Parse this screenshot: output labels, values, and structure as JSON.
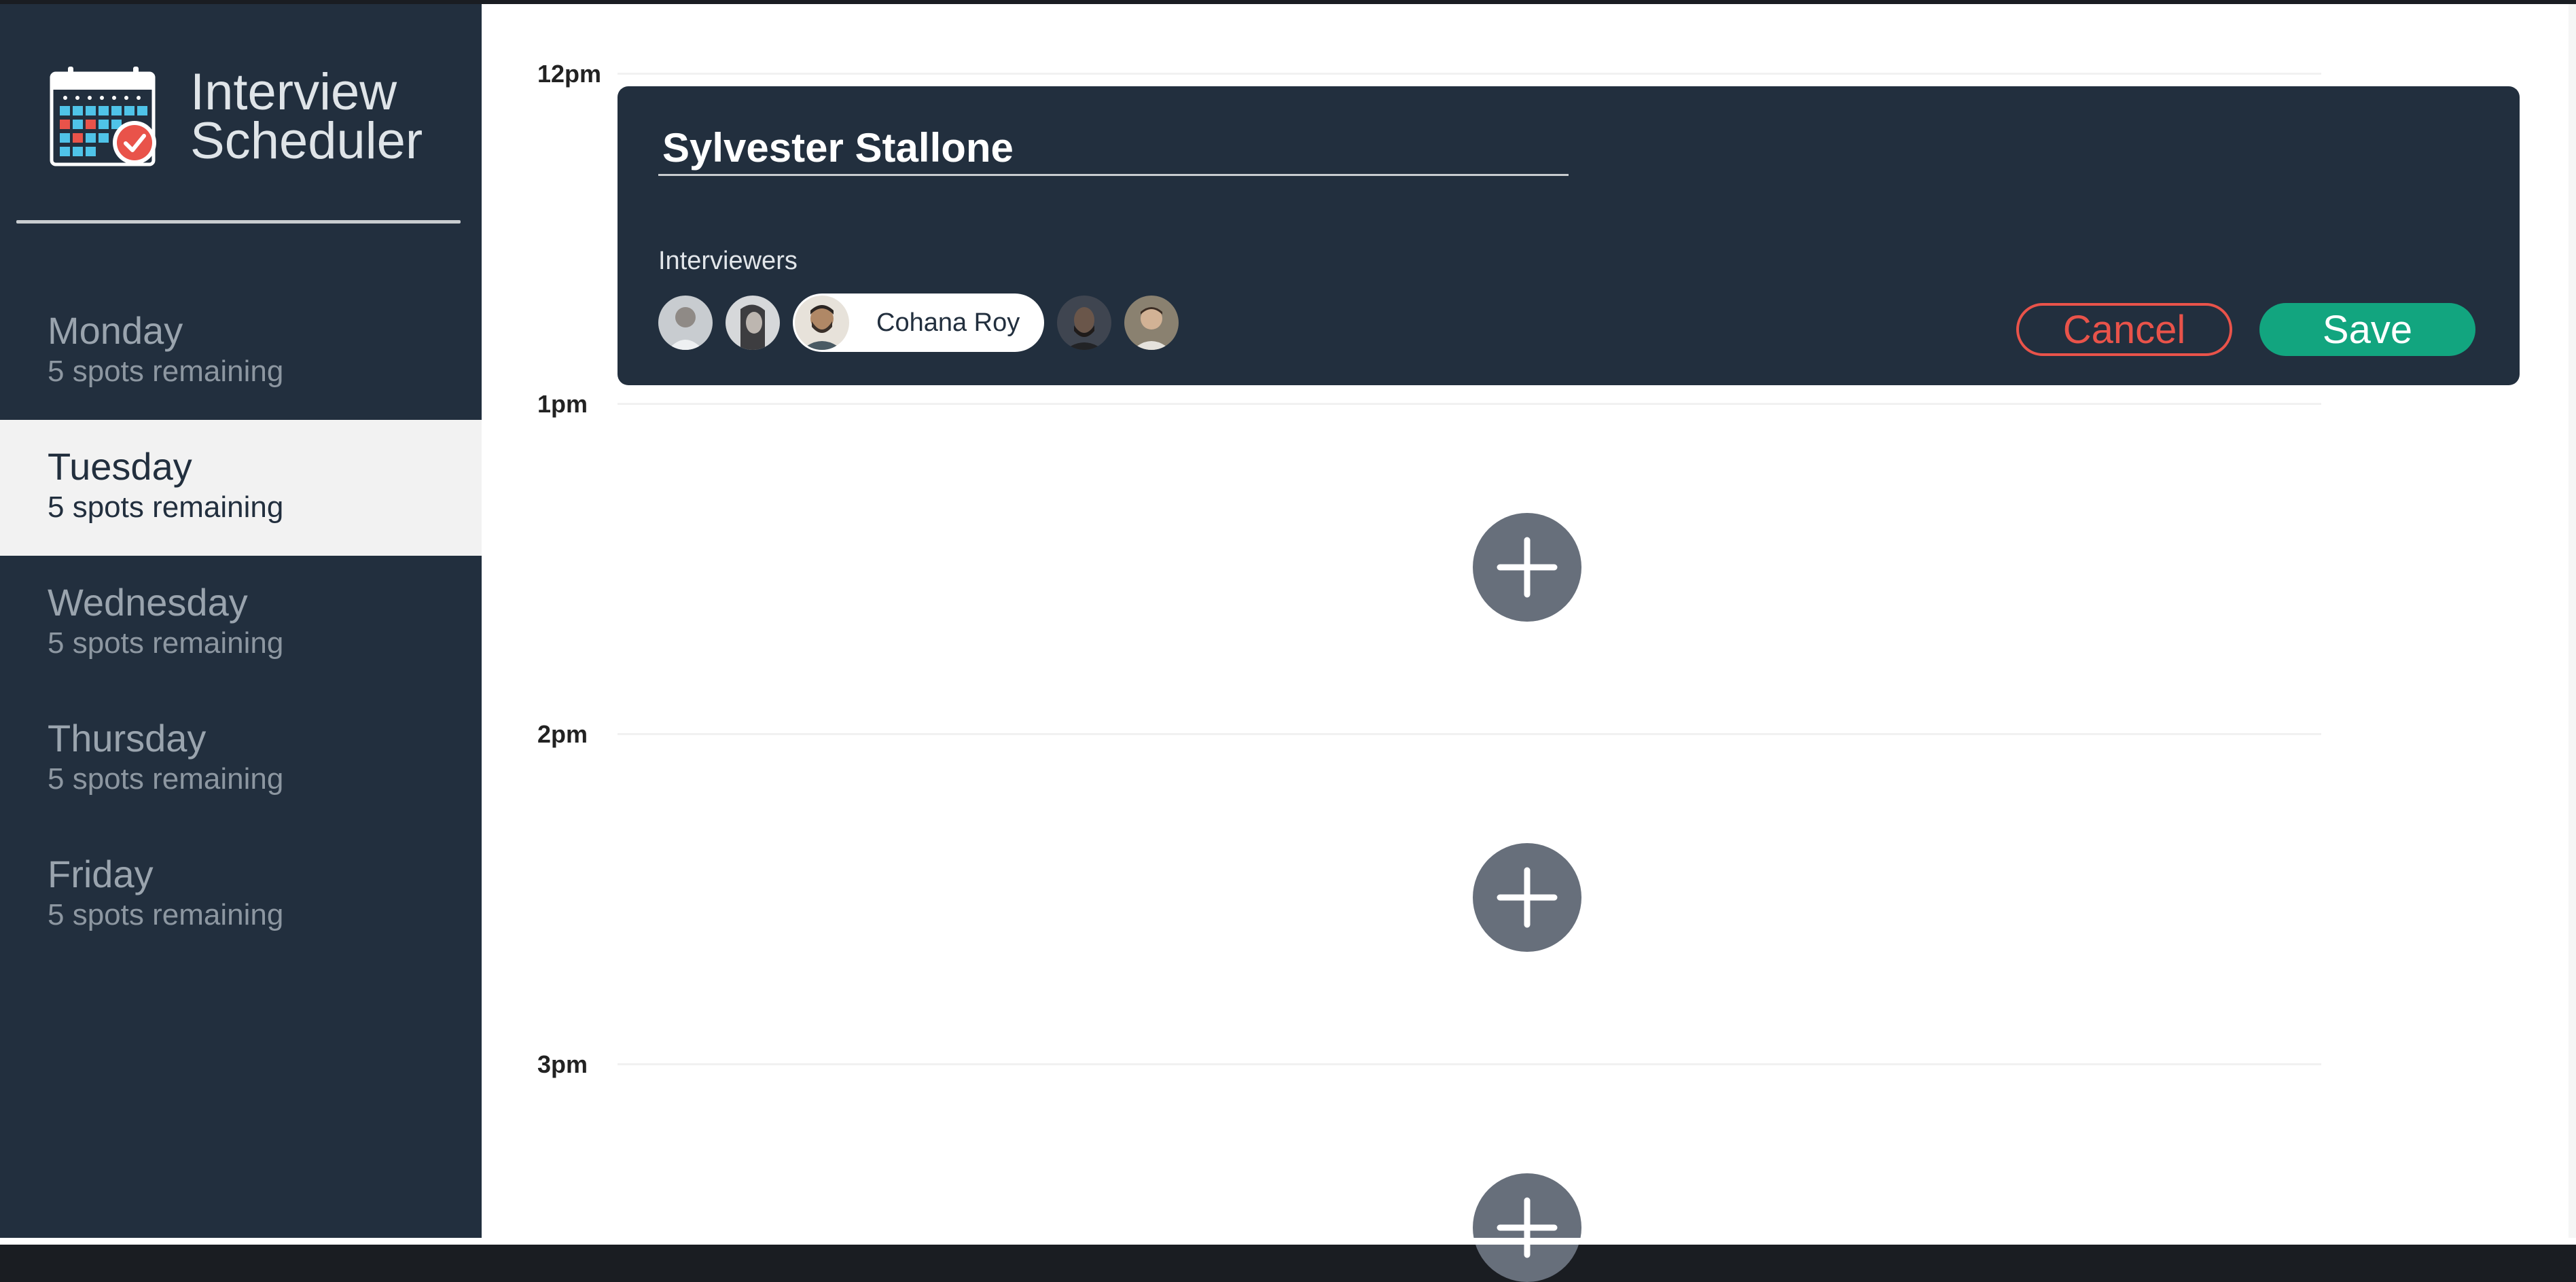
{
  "app": {
    "title_line1": "Interview",
    "title_line2": "Scheduler",
    "logo_icon": "calendar-check-icon"
  },
  "sidebar": {
    "days": [
      {
        "name": "Monday",
        "spots": "5 spots remaining",
        "selected": false
      },
      {
        "name": "Tuesday",
        "spots": "5 spots remaining",
        "selected": true
      },
      {
        "name": "Wednesday",
        "spots": "5 spots remaining",
        "selected": false
      },
      {
        "name": "Thursday",
        "spots": "5 spots remaining",
        "selected": false
      },
      {
        "name": "Friday",
        "spots": "5 spots remaining",
        "selected": false
      }
    ]
  },
  "schedule": {
    "times": [
      "12pm",
      "1pm",
      "2pm",
      "3pm"
    ],
    "add_icon": "plus-icon"
  },
  "form": {
    "student_name": "Sylvester Stallone",
    "interviewers_label": "Interviewers",
    "selected_interviewer": "Cohana Roy",
    "cancel_label": "Cancel",
    "save_label": "Save"
  },
  "colors": {
    "sidebar_bg": "#222f3e",
    "selected_day_bg": "#f2f2f2",
    "add_button": "#676f7b",
    "cancel": "#e9534a",
    "save": "#12a57f"
  }
}
